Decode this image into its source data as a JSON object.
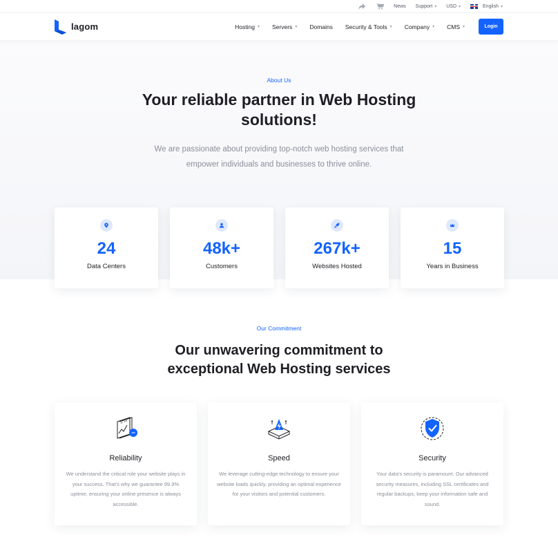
{
  "topbar": {
    "icons": [
      "share-icon",
      "cart-icon"
    ],
    "news": "News",
    "support": "Support",
    "currency": "USD",
    "language": "English"
  },
  "brand": {
    "name": "lagom",
    "color": "#1463ff"
  },
  "nav": {
    "items": [
      {
        "label": "Hosting",
        "dropdown": true
      },
      {
        "label": "Servers",
        "dropdown": true
      },
      {
        "label": "Domains",
        "dropdown": false
      },
      {
        "label": "Security & Tools",
        "dropdown": true
      },
      {
        "label": "Company",
        "dropdown": true
      },
      {
        "label": "CMS",
        "dropdown": true
      }
    ],
    "login": "Login"
  },
  "hero": {
    "eyebrow": "About Us",
    "title": "Your reliable partner in Web Hosting solutions!",
    "subtitle": "We are passionate about providing top-notch web hosting services that empower individuals and businesses to thrive online."
  },
  "stats": [
    {
      "icon": "location-pin-icon",
      "value": "24",
      "label": "Data Centers"
    },
    {
      "icon": "user-icon",
      "value": "48k+",
      "label": "Customers"
    },
    {
      "icon": "rocket-icon",
      "value": "267k+",
      "label": "Websites Hosted"
    },
    {
      "icon": "crown-icon",
      "value": "15",
      "label": "Years in Business"
    }
  ],
  "commitment": {
    "eyebrow": "Our Commitment",
    "title": "Our unwavering commitment to exceptional Web Hosting services",
    "features": [
      {
        "icon": "uptime-chart-icon",
        "title": "Reliability",
        "text": "We understand the critical role your website plays in your success. That's why we guarantee 99.9% uptime, ensuring your online presence is always accessible."
      },
      {
        "icon": "lightning-server-icon",
        "title": "Speed",
        "text": "We leverage cutting-edge technology to ensure your website loads quickly, providing an optimal experience for your visitors and potential customers."
      },
      {
        "icon": "shield-check-icon",
        "title": "Security",
        "text": "Your data's security is paramount. Our advanced security measures, including SSL certificates and regular backups, keep your information safe and sound."
      }
    ]
  }
}
